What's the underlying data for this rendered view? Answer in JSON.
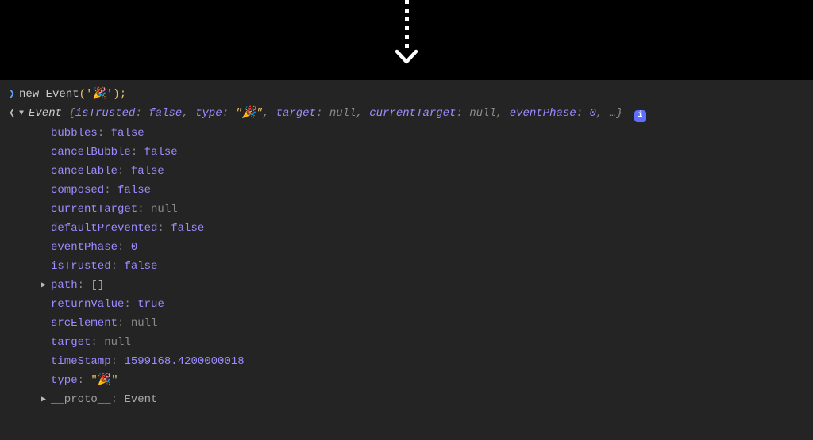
{
  "arrow": true,
  "input": {
    "keyword": "new",
    "className": "Event",
    "openParen": "('",
    "emoji": "🎉",
    "closeParen": "');"
  },
  "summary": {
    "toggle": "▼",
    "className": "Event",
    "open": " {",
    "pairs": [
      {
        "key": "isTrusted",
        "type": "bool",
        "value": "false"
      },
      {
        "key": "type",
        "type": "emoji-str",
        "value": "🎉"
      },
      {
        "key": "target",
        "type": "null",
        "value": "null"
      },
      {
        "key": "currentTarget",
        "type": "null",
        "value": "null"
      },
      {
        "key": "eventPhase",
        "type": "num",
        "value": "0"
      }
    ],
    "ellipsis": ", …}",
    "info": "i"
  },
  "props": [
    {
      "toggle": "",
      "key": "bubbles",
      "type": "bool",
      "value": "false"
    },
    {
      "toggle": "",
      "key": "cancelBubble",
      "type": "bool",
      "value": "false"
    },
    {
      "toggle": "",
      "key": "cancelable",
      "type": "bool",
      "value": "false"
    },
    {
      "toggle": "",
      "key": "composed",
      "type": "bool",
      "value": "false"
    },
    {
      "toggle": "",
      "key": "currentTarget",
      "type": "null",
      "value": "null"
    },
    {
      "toggle": "",
      "key": "defaultPrevented",
      "type": "bool",
      "value": "false"
    },
    {
      "toggle": "",
      "key": "eventPhase",
      "type": "num",
      "value": "0"
    },
    {
      "toggle": "",
      "key": "isTrusted",
      "type": "bool",
      "value": "false"
    },
    {
      "toggle": "▶",
      "key": "path",
      "type": "array",
      "value": "[]"
    },
    {
      "toggle": "",
      "key": "returnValue",
      "type": "bool",
      "value": "true"
    },
    {
      "toggle": "",
      "key": "srcElement",
      "type": "null",
      "value": "null"
    },
    {
      "toggle": "",
      "key": "target",
      "type": "null",
      "value": "null"
    },
    {
      "toggle": "",
      "key": "timeStamp",
      "type": "num",
      "value": "1599168.4200000018"
    },
    {
      "toggle": "",
      "key": "type",
      "type": "emoji-str",
      "value": "🎉"
    },
    {
      "toggle": "▶",
      "key": "__proto__",
      "type": "proto",
      "value": "Event",
      "dimKey": true
    }
  ]
}
